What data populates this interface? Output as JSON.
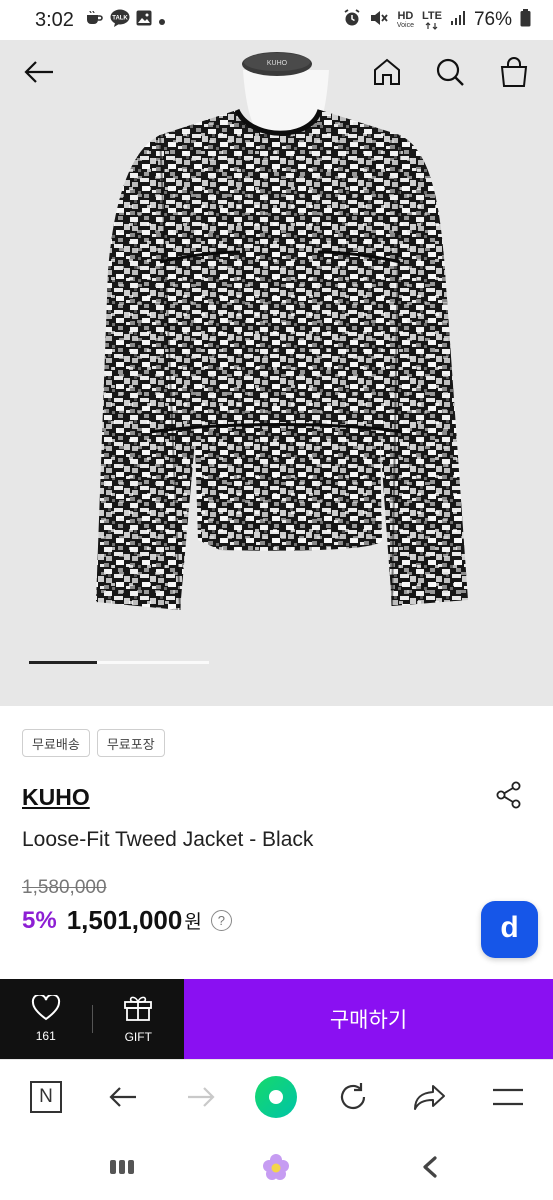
{
  "status_bar": {
    "time": "3:02",
    "battery_percent": "76%",
    "network_labels": {
      "hd": "HD",
      "voice": "Voice",
      "lte": "LTE"
    },
    "left_icons": [
      "coffee-icon",
      "talk-icon",
      "gallery-icon",
      "dot-icon"
    ],
    "right_icons": [
      "alarm-icon",
      "mute-icon",
      "signal-icon",
      "battery-icon"
    ]
  },
  "product_nav": {
    "icons": [
      "back-arrow-icon",
      "home-icon",
      "search-icon",
      "shopping-bag-icon"
    ]
  },
  "image_carousel": {
    "progress_fraction": 0.375
  },
  "mannequin_tag": "KUHO",
  "chips": [
    "무료배송",
    "무료포장"
  ],
  "product": {
    "brand": "KUHO",
    "name": "Loose-Fit Tweed Jacket - Black",
    "original_price": "1,580,000",
    "discount": "5%",
    "sale_price": "1,501,000",
    "currency": "원",
    "help_mark": "?",
    "d_button_label": "d"
  },
  "purchase_bar": {
    "like_count": "161",
    "gift_label": "GIFT",
    "buy_label": "구매하기",
    "buy_color": "#8a10f2"
  },
  "browser_toolbar": {
    "n_label": "N",
    "icons": [
      "naver-n-icon",
      "back-icon",
      "forward-icon",
      "home-green-icon",
      "refresh-icon",
      "share-icon",
      "menu-icon"
    ]
  },
  "system_nav": {
    "icons": [
      "recent-apps-icon",
      "home-flower-icon",
      "system-back-icon"
    ]
  },
  "colors": {
    "accent_purple": "#8a10f2",
    "discount_purple": "#8d1fd4",
    "d_blue": "#1656e8",
    "naver_green": "#03c75a"
  }
}
